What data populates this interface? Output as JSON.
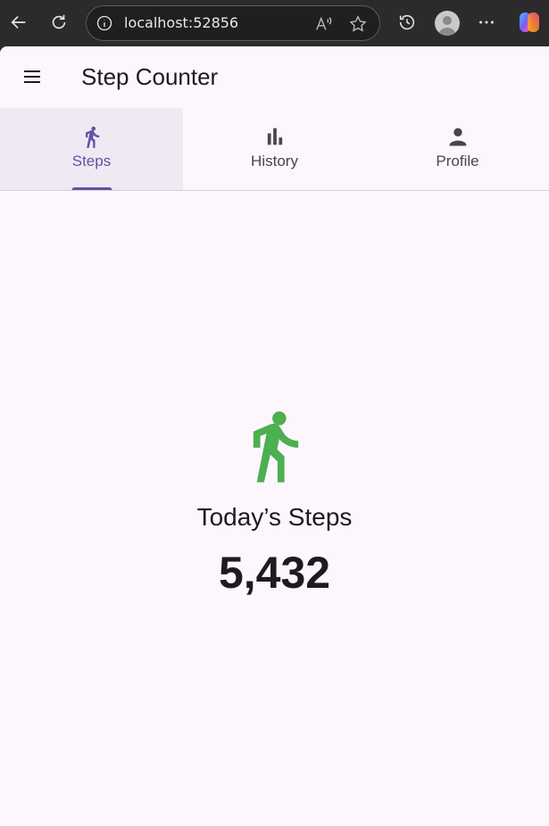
{
  "browser": {
    "url": "localhost:52856"
  },
  "app": {
    "title": "Step Counter",
    "tabs": [
      {
        "label": "Steps",
        "icon": "walk-icon",
        "active": true
      },
      {
        "label": "History",
        "icon": "bar-chart-icon",
        "active": false
      },
      {
        "label": "Profile",
        "icon": "person-icon",
        "active": false
      }
    ],
    "main": {
      "heading": "Today’s Steps",
      "value": "5,432",
      "icon": "walk-icon",
      "icon_color": "#4caf50"
    },
    "colors": {
      "accent": "#6750a4",
      "background": "#fdf7fd",
      "active_tab_bg": "#efe9f3"
    }
  }
}
